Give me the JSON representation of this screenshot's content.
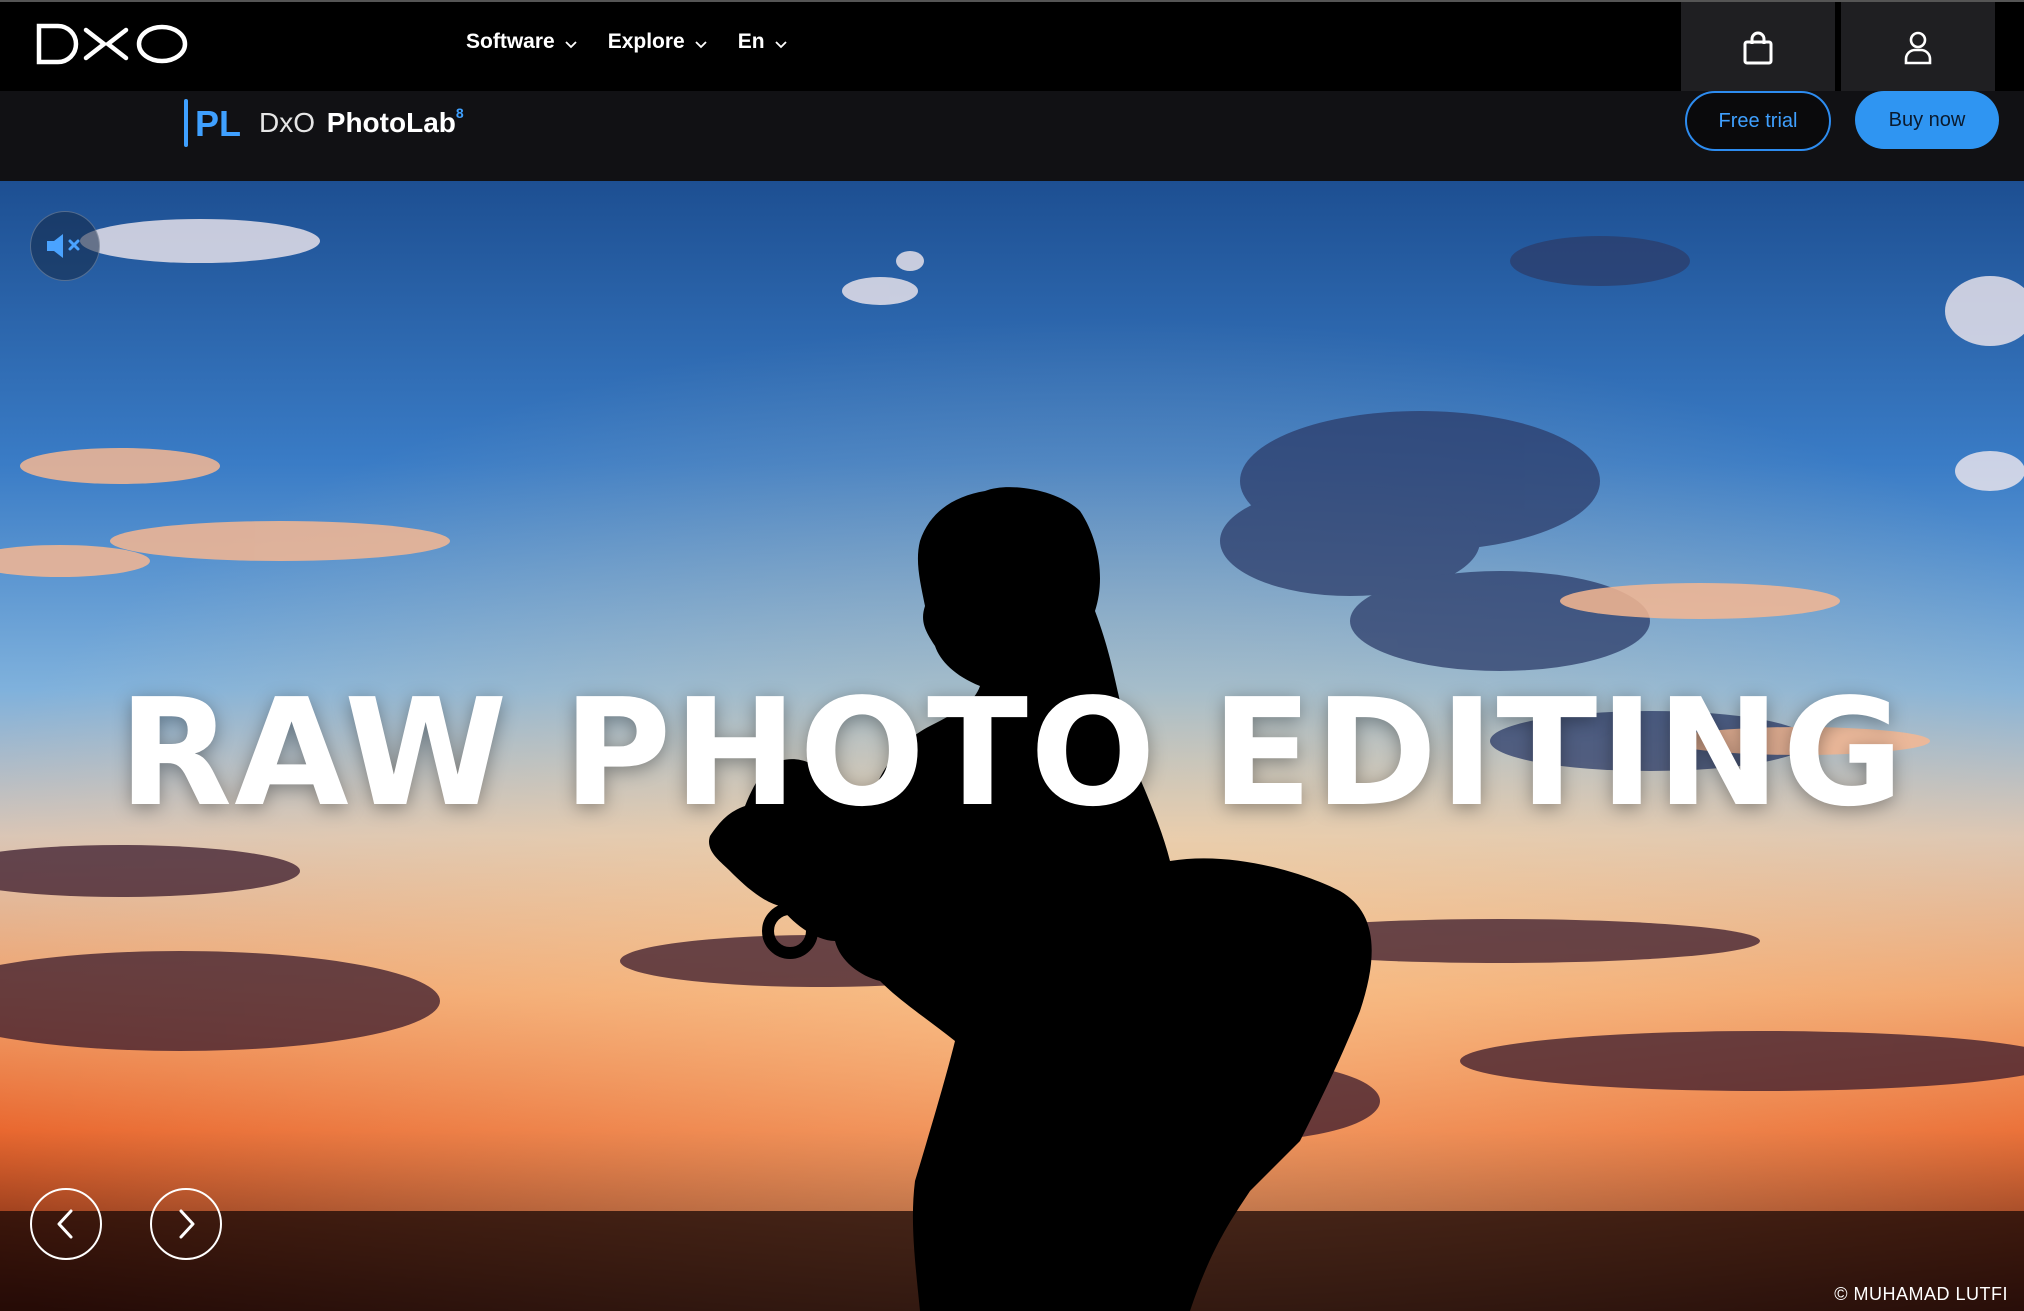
{
  "topbar": {
    "logo_text": "DXO",
    "nav": [
      {
        "label": "Software"
      },
      {
        "label": "Explore"
      },
      {
        "label": "En"
      }
    ],
    "cart_icon": "shopping-bag-icon",
    "account_icon": "user-icon"
  },
  "product": {
    "badge": "PL",
    "brand": "DxO",
    "name": "PhotoLab",
    "version": "8",
    "free_trial_label": "Free trial",
    "buy_now_label": "Buy now"
  },
  "hero": {
    "title": "RAW PHOTO EDITING",
    "credit": "© MUHAMAD LUTFI",
    "mute_icon": "speaker-muted-icon",
    "prev_icon": "chevron-left-icon",
    "next_icon": "chevron-right-icon"
  },
  "colors": {
    "accent": "#2f95f2",
    "topbar_bg": "#000000",
    "productbar_bg": "#111114"
  }
}
